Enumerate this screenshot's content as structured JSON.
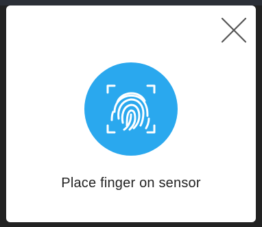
{
  "dialog": {
    "prompt_text": "Place finger on sensor",
    "close_icon": "close-icon",
    "fingerprint_icon": "fingerprint-icon"
  },
  "colors": {
    "accent": "#2aa8ee",
    "dialog_background": "#ffffff",
    "text": "#222222",
    "close_icon": "#555555"
  }
}
